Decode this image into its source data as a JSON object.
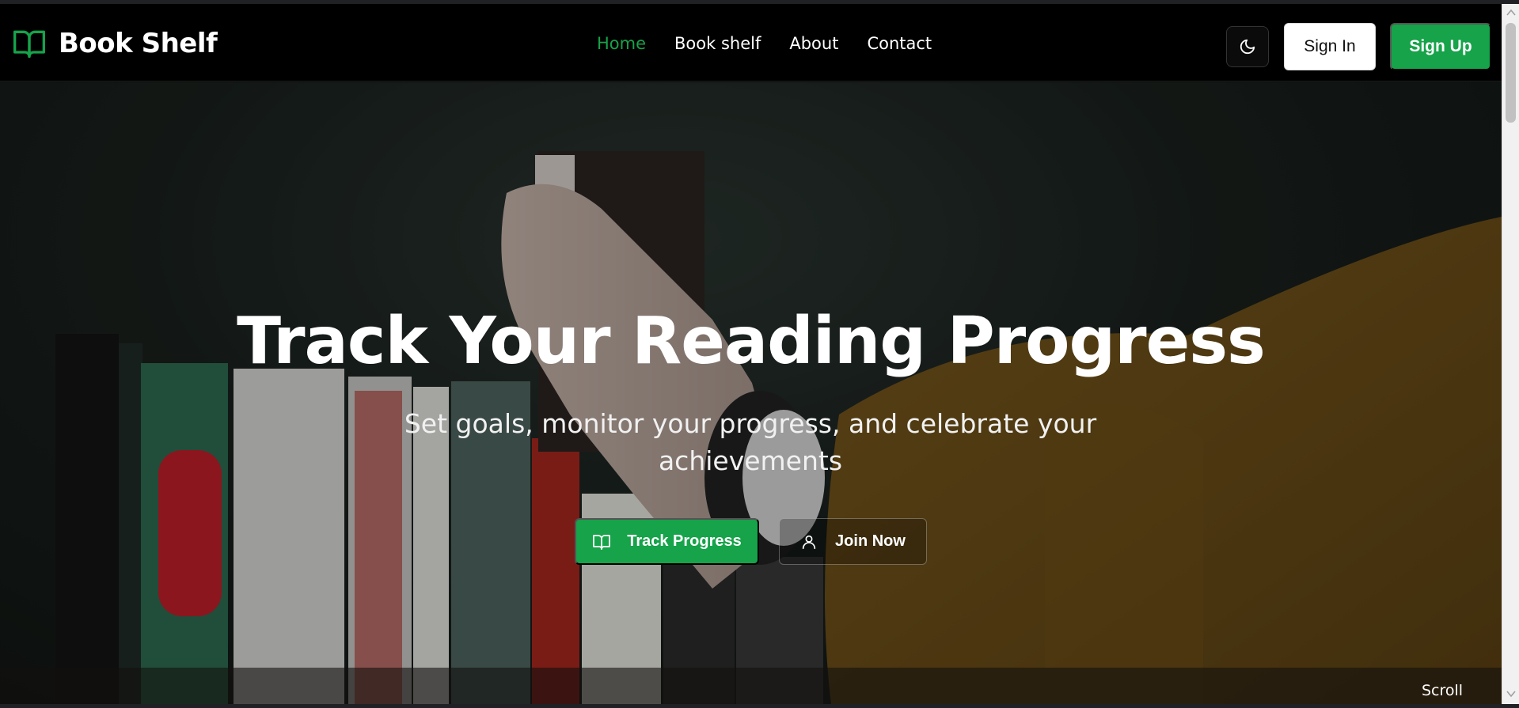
{
  "brand": {
    "name": "Book Shelf",
    "icon": "open-book-icon",
    "accent": "#16a34a"
  },
  "nav": {
    "links": [
      {
        "label": "Home",
        "active": true
      },
      {
        "label": "Book shelf",
        "active": false
      },
      {
        "label": "About",
        "active": false
      },
      {
        "label": "Contact",
        "active": false
      }
    ],
    "theme_toggle_icon": "moon-icon",
    "signin_label": "Sign In",
    "signup_label": "Sign Up"
  },
  "hero": {
    "title": "Track Your Reading Progress",
    "subtitle": "Set goals, monitor your progress, and celebrate your achievements",
    "primary_button": {
      "label": "Track Progress",
      "icon": "open-book-icon"
    },
    "secondary_button": {
      "label": "Join Now",
      "icon": "user-icon"
    },
    "scroll_label": "Scroll"
  },
  "colors": {
    "nav_bg": "#000000",
    "primary": "#16a34a",
    "text": "#ffffff"
  }
}
